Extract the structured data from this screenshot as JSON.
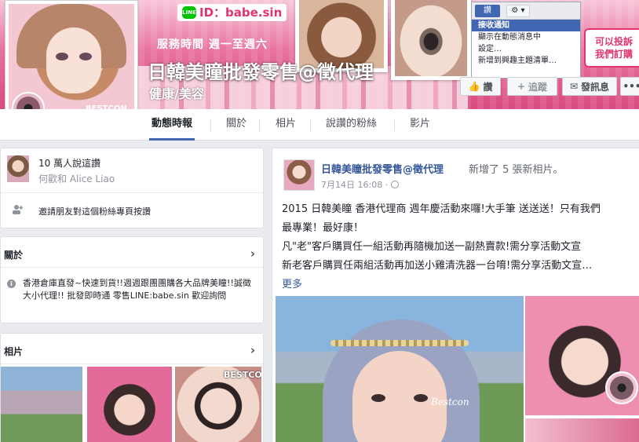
{
  "cover": {
    "line_id": "ID：babe.sin",
    "line_icon": "LINE",
    "hours": "服務時間 週一至週六",
    "order_line1": "可以投訴",
    "order_line2": "我們訂購",
    "menu": {
      "like_label": "讚",
      "gear_label": "⚙ ▾",
      "items": [
        "接收通知",
        "顯示在動態消息中",
        "設定…",
        "新增到興趣主題清單…"
      ]
    }
  },
  "page": {
    "title": "日韓美瞳批發零售@徵代理",
    "category": "健康/美容"
  },
  "profile_pic": {
    "brand": "BESTCON"
  },
  "actions": {
    "like": "讚",
    "follow": "追蹤",
    "message": "發訊息",
    "more": "•••"
  },
  "tabs": [
    {
      "label": "動態時報",
      "active": true
    },
    {
      "label": "關於"
    },
    {
      "label": "相片"
    },
    {
      "label": "說讚的粉絲"
    },
    {
      "label": "影片"
    }
  ],
  "likes": {
    "count": "10 萬人說這讚",
    "friends": "何歡和 Alice Liao",
    "invite": "邀請朋友對這個粉絲專頁按讚"
  },
  "about": {
    "header": "關於",
    "text": "香港倉庫直發~快速到貨!!週週跟團團購各大品牌美瞳!!誠徵大小代理!! 批發即時通 零售LINE:babe.sin 歡迎詢問"
  },
  "photos": {
    "header": "相片",
    "thumb_label": "BESTCON"
  },
  "post": {
    "author": "日韓美瞳批發零售@徵代理",
    "action": "新增了 5 張新相片。",
    "date": "7月14日 16:08 ·",
    "lines": [
      "2015 日韓美瞳 香港代理商 週年慶活動來囉!大手筆 送送送！只有我們",
      "最專業！最好康！",
      "凡\"老\"客戶購買任一組活動再隨機加送一副熱賣款!需分享活動文宣",
      "新老客戶購買任兩組活動再加送小雞清洗器一台唷!需分享活動文宣…"
    ],
    "see_more": "更多",
    "photo_brand": "Bestcon"
  },
  "colors": {
    "brand_blue": "#4267b2",
    "link_blue": "#365899",
    "cover_pink": "#d94a80"
  }
}
